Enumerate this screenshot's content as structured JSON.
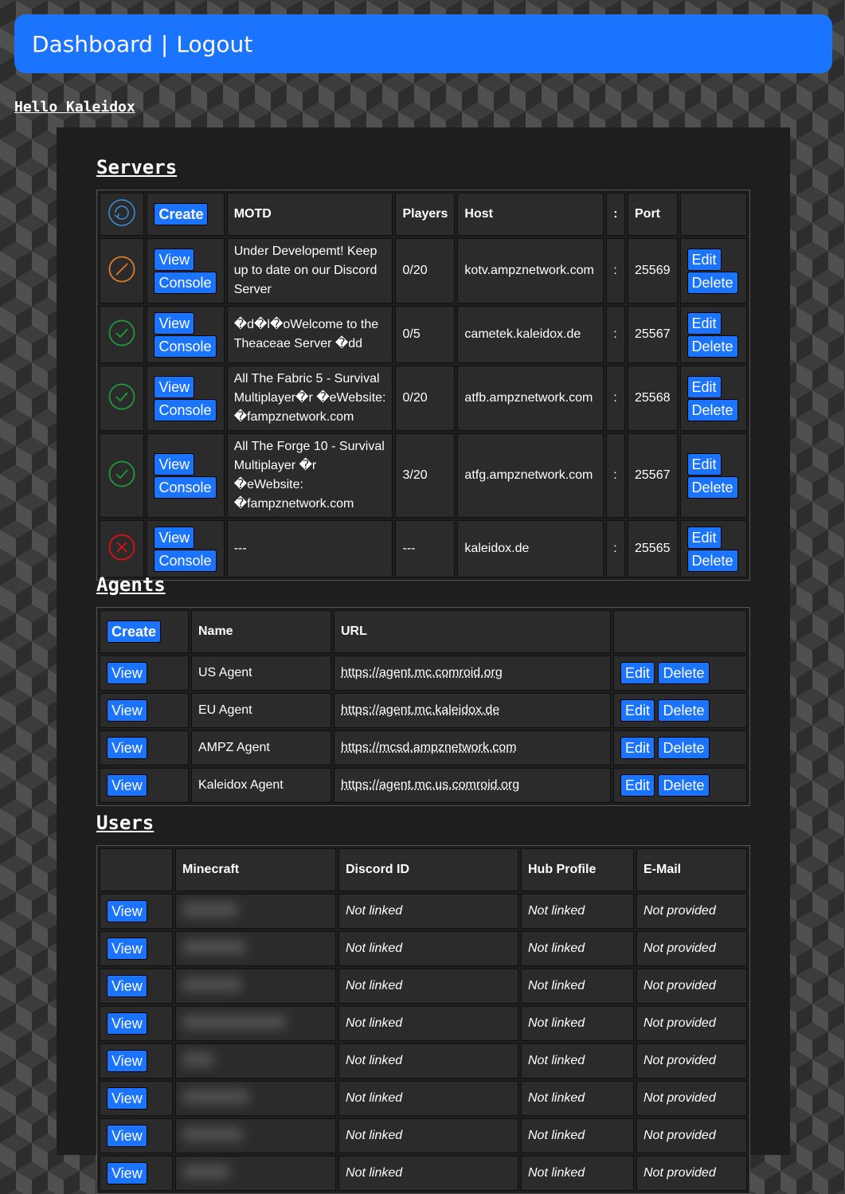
{
  "nav": {
    "dashboard": "Dashboard",
    "separator": "|",
    "logout": "Logout"
  },
  "greeting": "Hello Kaleidox",
  "servers": {
    "heading": "Servers",
    "create_label": "Create",
    "columns": {
      "motd": "MOTD",
      "players": "Players",
      "host": "Host",
      "colon": ":",
      "port": "Port"
    },
    "view_label": "View",
    "console_label": "Console",
    "edit_label": "Edit",
    "delete_label": "Delete",
    "rows": [
      {
        "status": "maintenance-icon",
        "motd": "Under Developemt! Keep up to date on our Discord Server",
        "players": "0/20",
        "host": "kotv.ampznetwork.com",
        "colon": ":",
        "port": "25569"
      },
      {
        "status": "online-icon",
        "motd": "�d�l�oWelcome to the Theaceae Server �dd",
        "players": "0/5",
        "host": "cametek.kaleidox.de",
        "colon": ":",
        "port": "25567"
      },
      {
        "status": "online-icon",
        "motd": "All The Fabric 5 - Survival Multiplayer�r �eWebsite: �fampznetwork.com",
        "players": "0/20",
        "host": "atfb.ampznetwork.com",
        "colon": ":",
        "port": "25568"
      },
      {
        "status": "online-icon",
        "motd": "All The Forge 10 - Survival Multiplayer �r �eWebsite: �fampznetwork.com",
        "players": "3/20",
        "host": "atfg.ampznetwork.com",
        "colon": ":",
        "port": "25567"
      },
      {
        "status": "offline-icon",
        "motd": "---",
        "players": "---",
        "host": "kaleidox.de",
        "colon": ":",
        "port": "25565"
      }
    ],
    "colors": {
      "maintenance": "#e07b2a",
      "online": "#1f9a3a",
      "offline": "#d11",
      "refresh": "#3a8fd8"
    }
  },
  "agents": {
    "heading": "Agents",
    "create_label": "Create",
    "columns": {
      "name": "Name",
      "url": "URL"
    },
    "view_label": "View",
    "edit_label": "Edit",
    "delete_label": "Delete",
    "rows": [
      {
        "name": "US Agent",
        "url": "https://agent.mc.comroid.org"
      },
      {
        "name": "EU Agent",
        "url": "https://agent.mc.kaleidox.de"
      },
      {
        "name": "AMPZ Agent",
        "url": "https://mcsd.ampznetwork.com"
      },
      {
        "name": "Kaleidox Agent",
        "url": "https://agent.mc.us.comroid.org"
      }
    ]
  },
  "users": {
    "heading": "Users",
    "columns": {
      "minecraft": "Minecraft",
      "discord": "Discord ID",
      "hub": "Hub Profile",
      "email": "E-Mail"
    },
    "view_label": "View",
    "rows": [
      {
        "discord": "Not linked",
        "hub": "Not linked",
        "email": "Not provided"
      },
      {
        "discord": "Not linked",
        "hub": "Not linked",
        "email": "Not provided"
      },
      {
        "discord": "Not linked",
        "hub": "Not linked",
        "email": "Not provided"
      },
      {
        "discord": "Not linked",
        "hub": "Not linked",
        "email": "Not provided"
      },
      {
        "discord": "Not linked",
        "hub": "Not linked",
        "email": "Not provided"
      },
      {
        "discord": "Not linked",
        "hub": "Not linked",
        "email": "Not provided"
      },
      {
        "discord": "Not linked",
        "hub": "Not linked",
        "email": "Not provided"
      },
      {
        "discord": "Not linked",
        "hub": "Not linked",
        "email": "Not provided"
      }
    ]
  }
}
